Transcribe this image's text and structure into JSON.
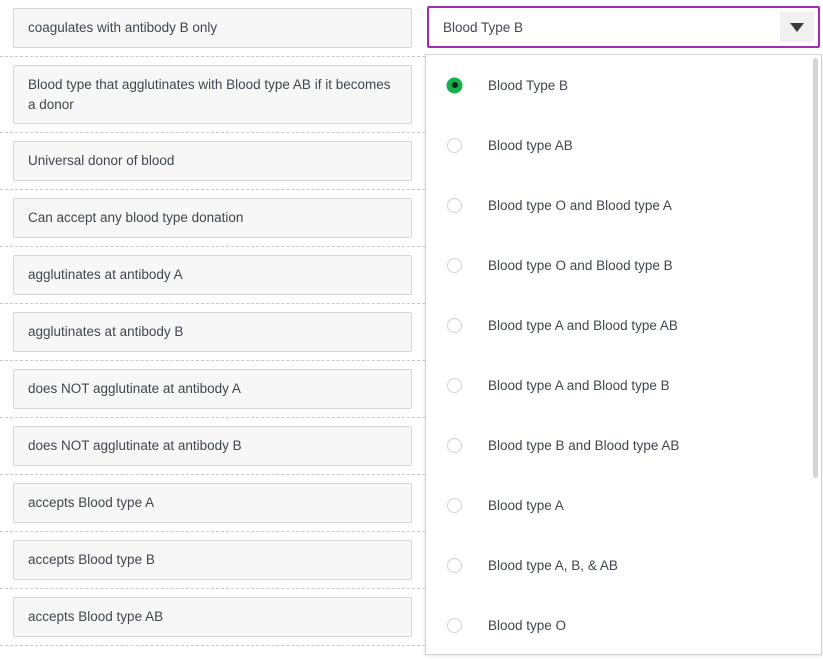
{
  "terms": {
    "items": [
      {
        "text": "coagulates with antibody B only"
      },
      {
        "text": "Blood type that agglutinates with Blood type AB if it becomes a donor"
      },
      {
        "text": "Universal donor of blood"
      },
      {
        "text": "Can accept any blood type donation"
      },
      {
        "text": "agglutinates at antibody A"
      },
      {
        "text": "agglutinates at antibody B"
      },
      {
        "text": "does NOT agglutinate at antibody A"
      },
      {
        "text": "does NOT agglutinate at antibody B"
      },
      {
        "text": "accepts Blood type A"
      },
      {
        "text": "accepts Blood type B"
      },
      {
        "text": "accepts Blood type AB"
      }
    ]
  },
  "answer_select": {
    "selected_value": "Blood Type B",
    "arrow_icon": "chevron-down-icon",
    "expanded": true,
    "accent_color": "#a12bb5",
    "selected_radio_color": "#16b04b",
    "options": [
      {
        "label": "Blood Type B",
        "selected": true
      },
      {
        "label": "Blood type AB",
        "selected": false
      },
      {
        "label": "Blood type O and Blood type A",
        "selected": false
      },
      {
        "label": "Blood type O and Blood type B",
        "selected": false
      },
      {
        "label": "Blood type A and Blood type AB",
        "selected": false
      },
      {
        "label": "Blood type A and Blood type B",
        "selected": false
      },
      {
        "label": "Blood type B and Blood type AB",
        "selected": false
      },
      {
        "label": "Blood type A",
        "selected": false
      },
      {
        "label": "Blood type A, B, & AB",
        "selected": false
      },
      {
        "label": "Blood type O",
        "selected": false
      }
    ]
  }
}
